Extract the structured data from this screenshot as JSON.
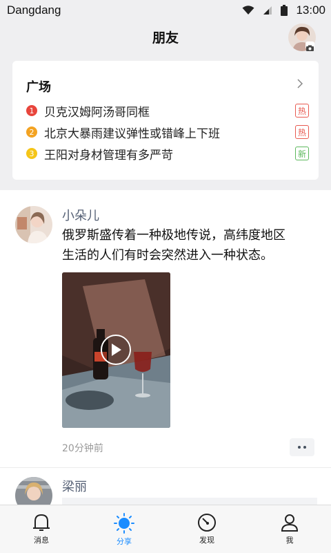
{
  "status_bar": {
    "carrier": "Dangdang",
    "time": "13:00"
  },
  "header": {
    "title": "朋友"
  },
  "plaza": {
    "title": "广场",
    "items": [
      {
        "rank": "1",
        "text": "贝克汉姆阿汤哥同框",
        "tag": "热",
        "rank_color": "#e8453c",
        "tag_color": "#e8594f"
      },
      {
        "rank": "2",
        "text": "北京大暴雨建议弹性或错峰上下班",
        "tag": "热",
        "rank_color": "#f3a322",
        "tag_color": "#e8594f"
      },
      {
        "rank": "3",
        "text": "王阳对身材管理有多严苛",
        "tag": "新",
        "rank_color": "#f5c518",
        "tag_color": "#5cb85c"
      }
    ]
  },
  "feed": [
    {
      "author": "小朵儿",
      "text_line1": "俄罗斯盛传着一种极地传说，高纬度地区",
      "text_line2": "生活的人们有时会突然进入一种状态。",
      "time": "20分钟前",
      "media": "video"
    },
    {
      "author": "梁丽"
    }
  ],
  "tabbar": {
    "tabs": [
      {
        "label": "消息",
        "icon": "bell-icon"
      },
      {
        "label": "分享",
        "icon": "sun-icon",
        "active": true
      },
      {
        "label": "发现",
        "icon": "compass-icon"
      },
      {
        "label": "我",
        "icon": "person-icon"
      }
    ],
    "accent": "#1a8cff"
  }
}
